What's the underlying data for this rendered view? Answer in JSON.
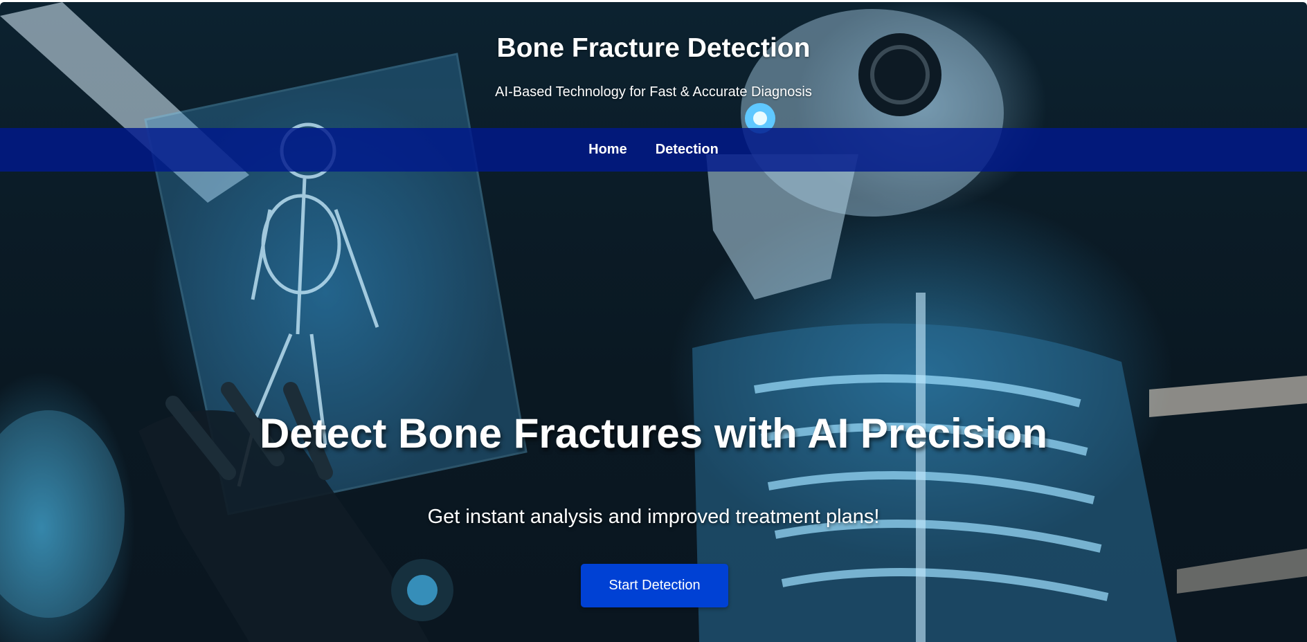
{
  "header": {
    "title": "Bone Fracture Detection",
    "tagline": "AI-Based Technology for Fast & Accurate Diagnosis"
  },
  "nav": {
    "items": [
      {
        "label": "Home"
      },
      {
        "label": "Detection"
      }
    ],
    "background_color": "#00198C"
  },
  "hero": {
    "headline": "Detect Bone Fractures with AI Precision",
    "subheadline": "Get instant analysis and improved treatment plans!",
    "cta_label": "Start Detection",
    "cta_color": "#0041D4",
    "background_image": "robot-skeleton-xray-illustration"
  }
}
